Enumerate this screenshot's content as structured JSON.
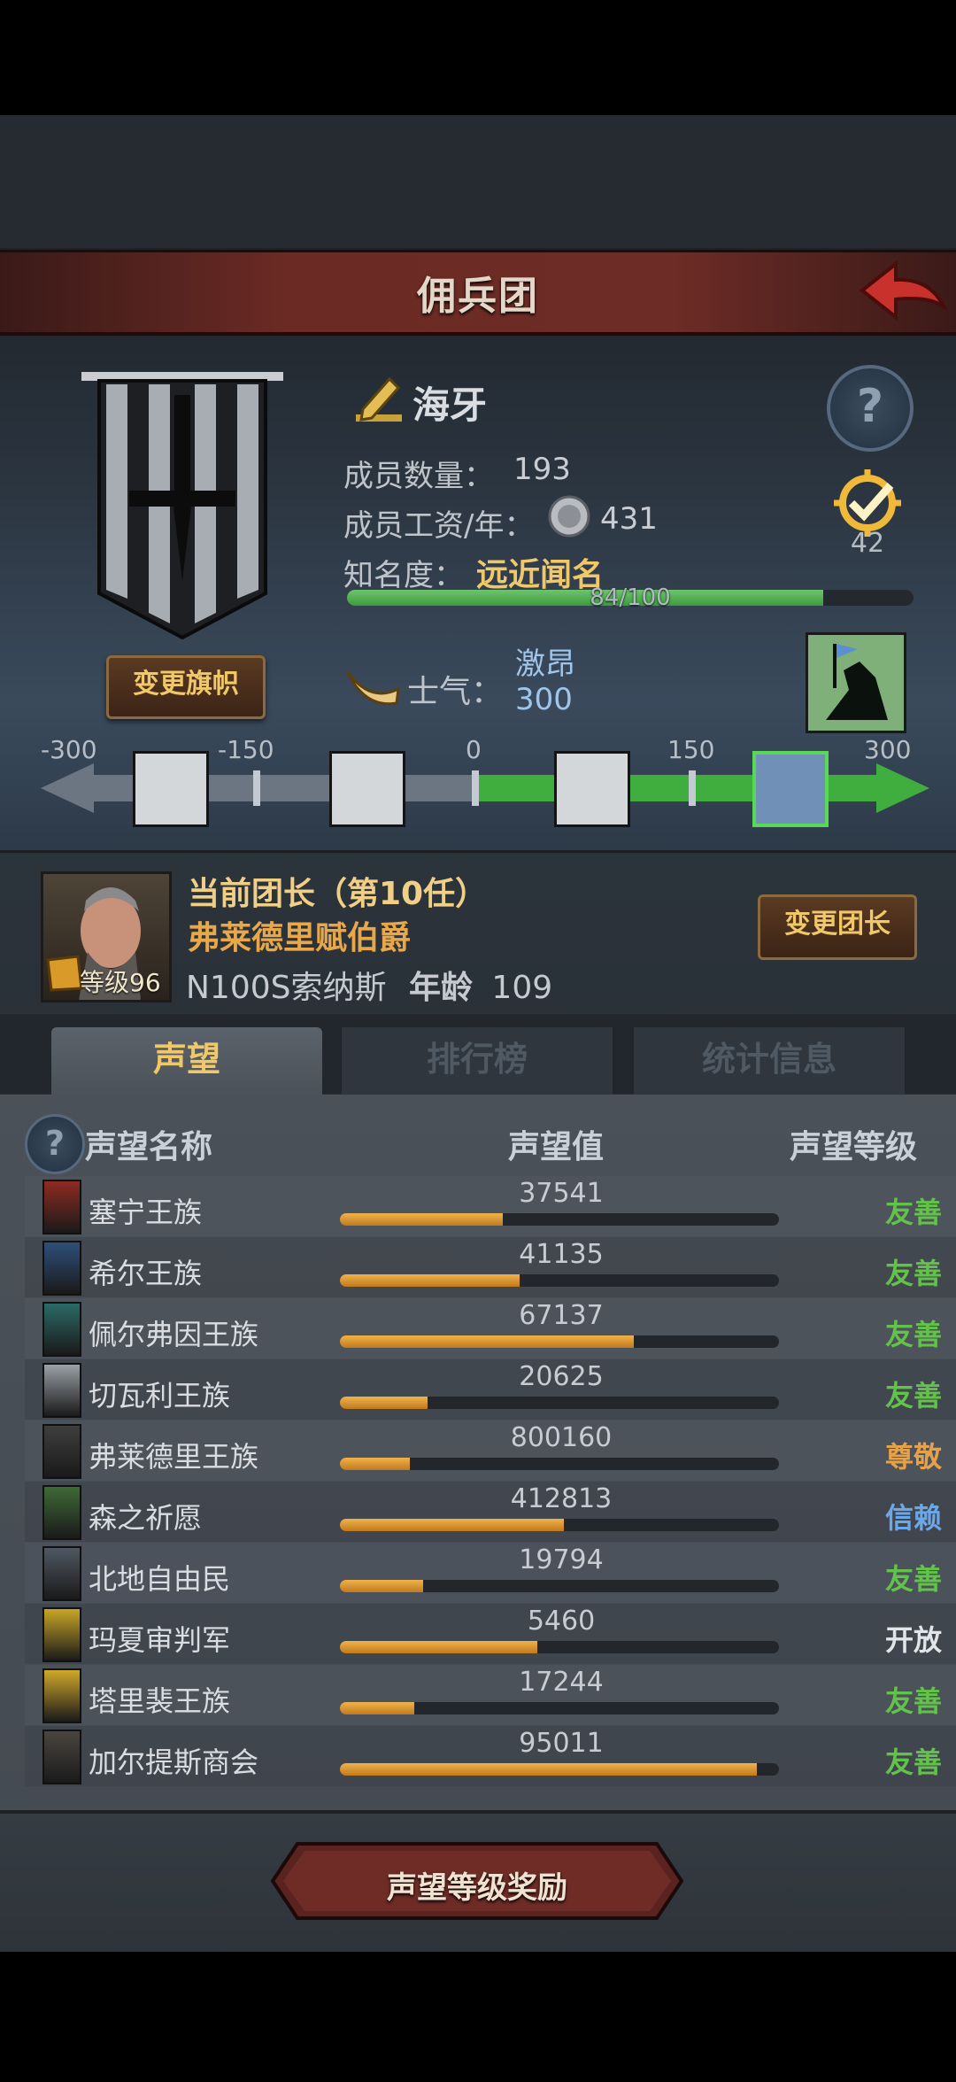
{
  "header": {
    "title": "佣兵团"
  },
  "mercenary": {
    "name": "海牙",
    "member_count_label": "成员数量：",
    "member_count": "193",
    "salary_label": "成员工资/年：",
    "salary": "431",
    "fame_label": "知名度：",
    "fame_title": "远近闻名",
    "fame_progress": "84/100",
    "fame_fraction": 0.84,
    "target_count": "42",
    "change_flag_label": "变更旗帜"
  },
  "morale": {
    "label": "士气：",
    "status": "激昂",
    "value": "300",
    "ticks": [
      "-300",
      "-150",
      "0",
      "150",
      "300"
    ]
  },
  "leader": {
    "title": "当前团长（第10任）",
    "name": "弗莱德里赋伯爵",
    "code": "N100S索纳斯",
    "age_label": "年龄",
    "age": "109",
    "level": "等级96",
    "change_label": "变更团长"
  },
  "tabs": [
    {
      "label": "声望"
    },
    {
      "label": "排行榜"
    },
    {
      "label": "统计信息"
    }
  ],
  "list": {
    "col_name": "声望名称",
    "col_value": "声望值",
    "col_level": "声望等级",
    "rows": [
      {
        "name": "塞宁王族",
        "value": "37541",
        "level": "友善",
        "fill": 0.37,
        "color": "#63c24a",
        "crest": "#8e2a22"
      },
      {
        "name": "希尔王族",
        "value": "41135",
        "level": "友善",
        "fill": 0.41,
        "color": "#63c24a",
        "crest": "#2f4f7a"
      },
      {
        "name": "佩尔弗因王族",
        "value": "67137",
        "level": "友善",
        "fill": 0.67,
        "color": "#63c24a",
        "crest": "#2a6a66"
      },
      {
        "name": "切瓦利王族",
        "value": "20625",
        "level": "友善",
        "fill": 0.2,
        "color": "#63c24a",
        "crest": "#9aa0a6"
      },
      {
        "name": "弗莱德里王族",
        "value": "800160",
        "level": "尊敬",
        "fill": 0.16,
        "color": "#e6a24a",
        "crest": "#3e3e3e"
      },
      {
        "name": "森之祈愿",
        "value": "412813",
        "level": "信赖",
        "fill": 0.51,
        "color": "#6aa8ea",
        "crest": "#3f6a36"
      },
      {
        "name": "北地自由民",
        "value": "19794",
        "level": "友善",
        "fill": 0.19,
        "color": "#63c24a",
        "crest": "#4f5862"
      },
      {
        "name": "玛夏审判军",
        "value": "5460",
        "level": "开放",
        "fill": 0.45,
        "color": "#e2e5e8",
        "crest": "#c9a526"
      },
      {
        "name": "塔里裴王族",
        "value": "17244",
        "level": "友善",
        "fill": 0.17,
        "color": "#63c24a",
        "crest": "#d0a82a"
      },
      {
        "name": "加尔提斯商会",
        "value": "95011",
        "level": "友善",
        "fill": 0.95,
        "color": "#63c24a",
        "crest": "#4a4540"
      }
    ]
  },
  "footer": {
    "reward_label": "声望等级奖励"
  }
}
